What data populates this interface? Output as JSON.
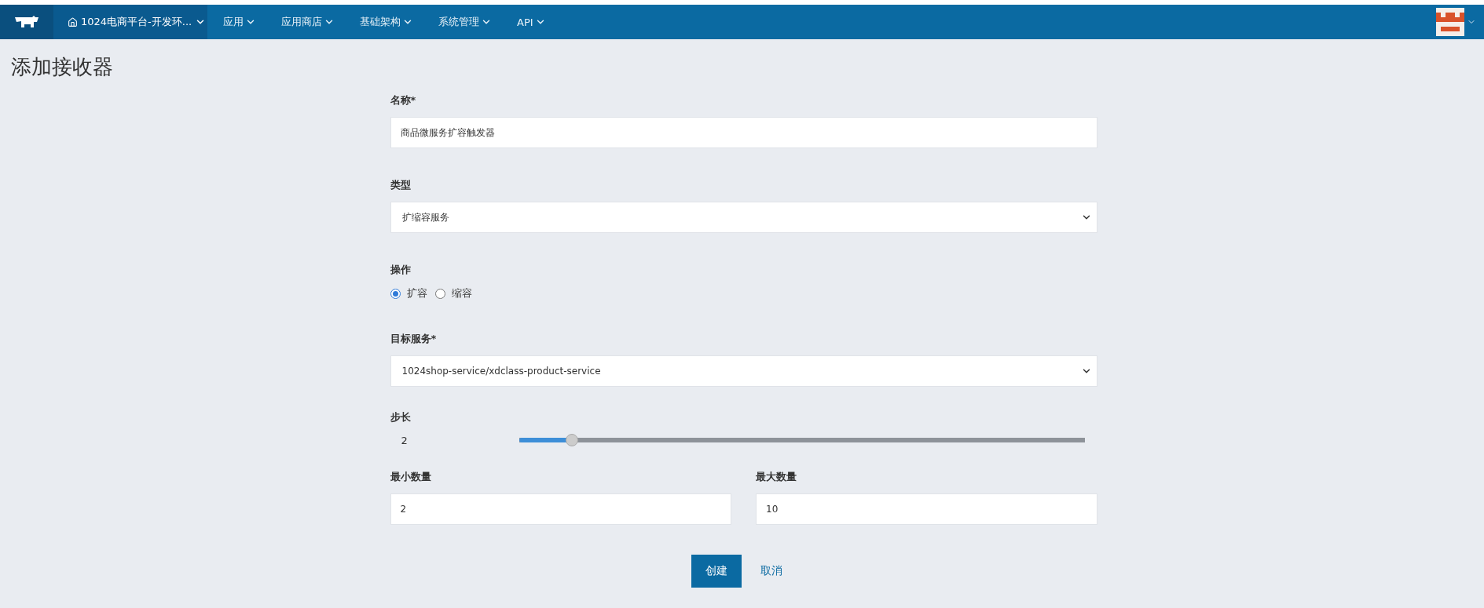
{
  "nav": {
    "environment": "1024电商平台-开发环...",
    "menus": [
      {
        "label": "应用"
      },
      {
        "label": "应用商店"
      },
      {
        "label": "基础架构"
      },
      {
        "label": "系统管理"
      },
      {
        "label": "API"
      }
    ]
  },
  "page_title": "添加接收器",
  "form": {
    "name": {
      "label": "名称*",
      "value": "商品微服务扩容触发器"
    },
    "type": {
      "label": "类型",
      "value": "扩缩容服务"
    },
    "action": {
      "label": "操作",
      "options": [
        {
          "label": "扩容",
          "selected": true
        },
        {
          "label": "缩容",
          "selected": false
        }
      ]
    },
    "target": {
      "label": "目标服务*",
      "value": "1024shop-service/xdclass-product-service"
    },
    "step": {
      "label": "步长",
      "reading": "2",
      "level": 0.094
    },
    "min": {
      "label": "最小数量",
      "value": "2"
    },
    "max": {
      "label": "最大数量",
      "value": "10"
    },
    "buttons": [
      {
        "label": "创建",
        "kind": "primary"
      },
      {
        "label": "取消",
        "kind": "link"
      }
    ]
  }
}
